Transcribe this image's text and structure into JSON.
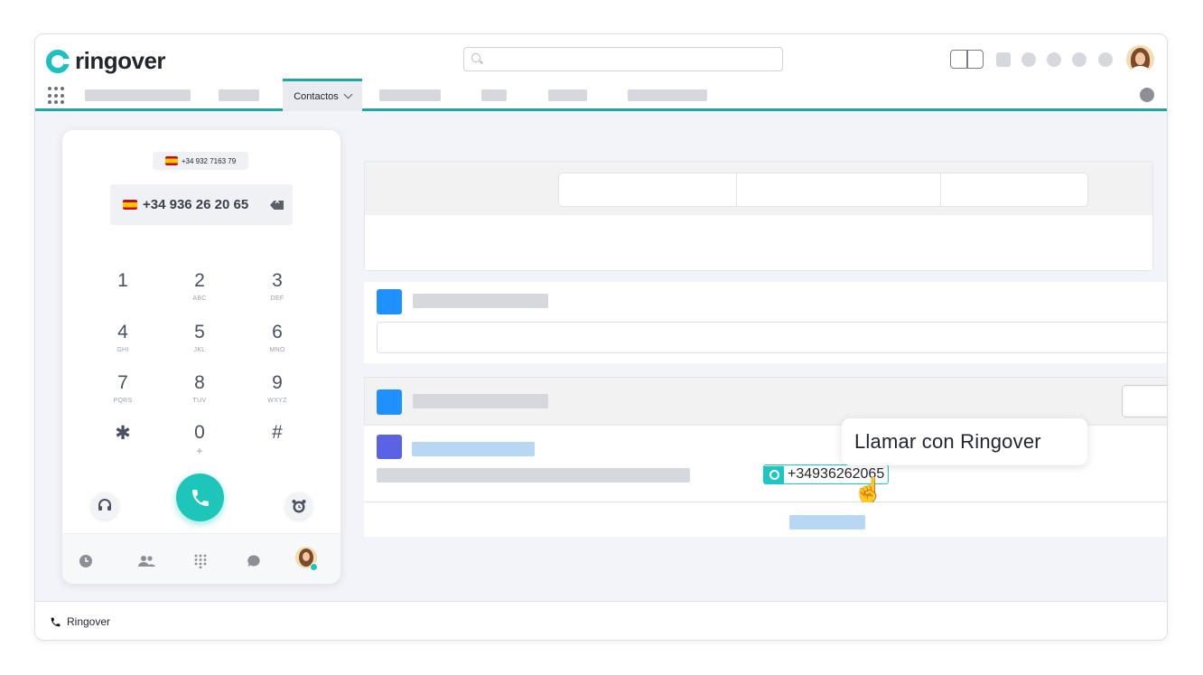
{
  "app": {
    "logo_text": "ringover",
    "brand_color": "#1cc0c0",
    "accent_color": "#1fa6a0"
  },
  "search": {
    "placeholder": ""
  },
  "nav": {
    "active_tab_label": "Contactos"
  },
  "dialer": {
    "caller_id": "+34 932 7163 79",
    "dialed_number": "+34 936 26 20 65",
    "keys": [
      {
        "digit": "1",
        "letters": ""
      },
      {
        "digit": "2",
        "letters": "ABC"
      },
      {
        "digit": "3",
        "letters": "DEF"
      },
      {
        "digit": "4",
        "letters": "GHI"
      },
      {
        "digit": "5",
        "letters": "JKL"
      },
      {
        "digit": "6",
        "letters": "MNO"
      },
      {
        "digit": "7",
        "letters": "PQRS"
      },
      {
        "digit": "8",
        "letters": "TUV"
      },
      {
        "digit": "9",
        "letters": "WXYZ"
      },
      {
        "digit": "✱",
        "letters": ""
      },
      {
        "digit": "0",
        "letters": "+"
      },
      {
        "digit": "#",
        "letters": ""
      }
    ]
  },
  "contact": {
    "phone_number": "+34936262065"
  },
  "tooltip": {
    "text": "Llamar con Ringover"
  },
  "statusbar": {
    "label": "Ringover"
  }
}
